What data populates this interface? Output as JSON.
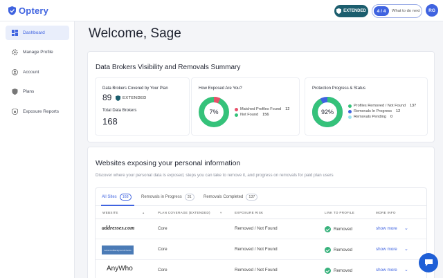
{
  "header": {
    "brand": "Optery",
    "plan_badge": "EXTENDED",
    "todo_count": "4 / 4",
    "todo_label": "What to do next",
    "avatar_initials": "RG"
  },
  "sidebar": {
    "items": [
      {
        "label": "Dashboard",
        "icon": "dashboard-icon",
        "active": true
      },
      {
        "label": "Manage Profile",
        "icon": "gear-icon"
      },
      {
        "label": "Account",
        "icon": "user-icon"
      },
      {
        "label": "Plans",
        "icon": "shield-icon"
      },
      {
        "label": "Exposure Reports",
        "icon": "report-icon"
      }
    ]
  },
  "welcome": "Welcome, Sage",
  "summary": {
    "title": "Data Brokers Visibility and Removals Summary",
    "covered_label": "Data Brokers Covered by Your Plan",
    "covered_value": "89",
    "covered_plan": "EXTENDED",
    "total_label": "Total Data Brokers",
    "total_value": "168",
    "exposed": {
      "title": "How Exposed Are You?",
      "percent_label": "7%",
      "percent": 7,
      "legend": [
        {
          "label": "Matched Profiles Found",
          "value": "12",
          "color": "#e8506a"
        },
        {
          "label": "Not Found",
          "value": "156",
          "color": "#35c27a"
        }
      ]
    },
    "progress": {
      "title": "Protection Progress & Status",
      "percent_label": "92%",
      "percent": 92,
      "legend": [
        {
          "label": "Profiles Removed / Not Found",
          "value": "137",
          "color": "#35c27a"
        },
        {
          "label": "Removals In Progress",
          "value": "12",
          "color": "#3f63e0"
        },
        {
          "label": "Removals Pending",
          "value": "0",
          "color": "#9be3f0"
        }
      ]
    }
  },
  "sites": {
    "title": "Websites exposing your personal information",
    "description": "Discover where your personal data is exposed, steps you can take to remove it, and progress on removals for paid plan users",
    "tabs": [
      {
        "label": "All Sites",
        "count": "168"
      },
      {
        "label": "Removals in Progress",
        "count": "31"
      },
      {
        "label": "Removals Completed",
        "count": "137"
      }
    ],
    "columns": [
      "WEBSITE",
      "PLAN COVERAGE (EXTENDED)",
      "EXPOSURE RISK",
      "LINK TO PROFILE",
      "MORE INFO"
    ],
    "rows": [
      {
        "website": "addresses.com",
        "coverage": "Core",
        "risk": "Removed / Not Found",
        "link": "Removed",
        "more": "show more"
      },
      {
        "website": "AdvancedBackgroundChecks",
        "coverage": "Core",
        "risk": "Removed / Not Found",
        "link": "Removed",
        "more": "show more"
      },
      {
        "website": "AnyWho",
        "coverage": "Core",
        "risk": "Removed / Not Found",
        "link": "Removed",
        "more": "show more"
      }
    ]
  }
}
